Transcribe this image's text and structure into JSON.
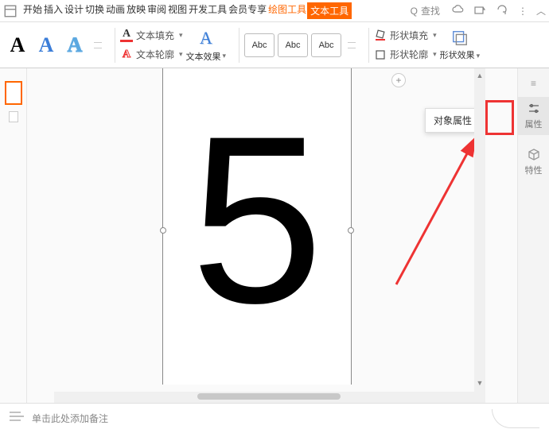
{
  "menu": {
    "items": [
      "开始",
      "插入",
      "设计",
      "切换",
      "动画",
      "放映",
      "审阅",
      "视图",
      "开发工具",
      "会员专享"
    ],
    "drawing": "绘图工具",
    "textTool": "文本工具",
    "search": "查找",
    "searchPrefix": "Q"
  },
  "ribbon": {
    "textFill": "文本填充",
    "textOutline": "文本轮廓",
    "textEffect": "文本效果",
    "abc": "Abc",
    "shapeFill": "形状填充",
    "shapeOutline": "形状轮廓",
    "shapeEffect": "形状效果"
  },
  "canvas": {
    "content": "5",
    "tooltip": "对象属性",
    "plus": "+"
  },
  "rightPanel": {
    "prop": "属性",
    "trait": "特性"
  },
  "notes": {
    "placeholder": "单击此处添加备注"
  }
}
